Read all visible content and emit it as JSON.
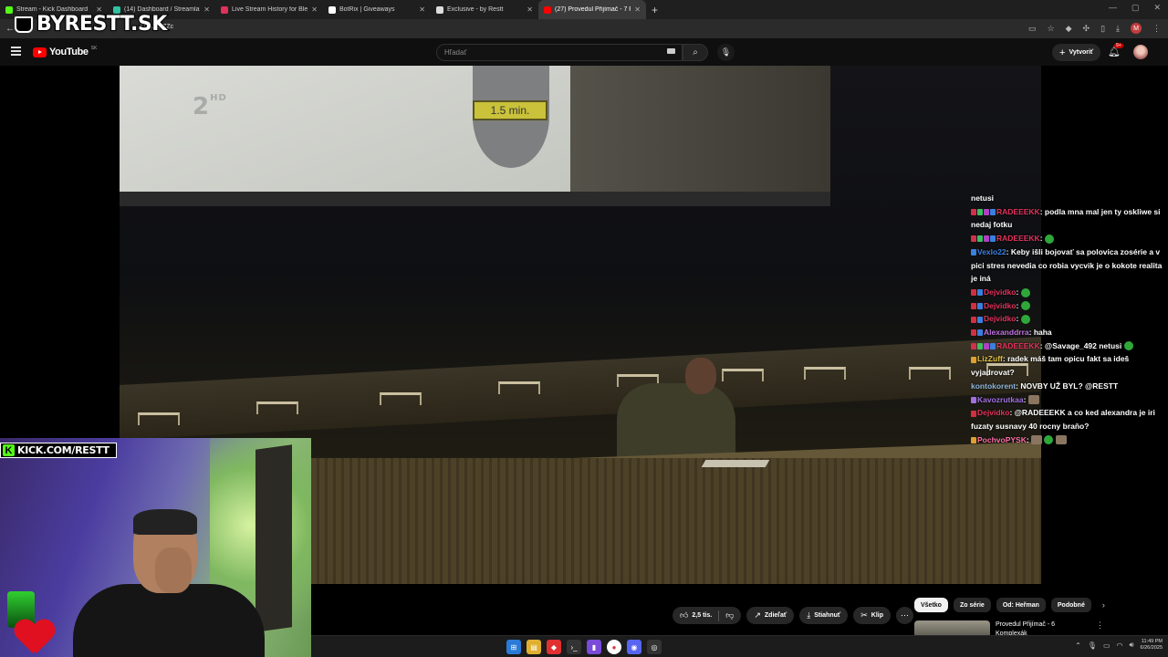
{
  "browser": {
    "tabs": [
      {
        "label": "Stream - Kick Dashboard",
        "color": "#53fc18",
        "active": false
      },
      {
        "label": "(14) Dashboard / Streamlabs",
        "color": "#31c3a2",
        "active": false
      },
      {
        "label": "Live Stream History for Blerp Si",
        "color": "#e0315a",
        "active": false
      },
      {
        "label": "BotRix | Giveaways",
        "color": "#ffffff",
        "active": false
      },
      {
        "label": "Exclusive - by Restt",
        "color": "#dddddd",
        "active": false
      },
      {
        "label": "(27) Provedul Přijímač - 7 P",
        "color": "#ff0000",
        "active": true
      }
    ],
    "url": "OTIJIUIZZc"
  },
  "overlay": {
    "logo_text": "BYRESTT.SK",
    "kick_text": "KICK.COM/RESTT"
  },
  "youtube": {
    "logo_text": "YouTube",
    "country_code": "SK",
    "search_placeholder": "Hľadať",
    "create_label": "Vytvoriť",
    "notif_count": "9+"
  },
  "video": {
    "channel_logo": "2",
    "channel_logo_hd": "HD",
    "timer_label": "1.5 min."
  },
  "chat": [
    {
      "user": "",
      "text": "netusi",
      "color": "#ffffff",
      "badges": []
    },
    {
      "user": "RADEEEKK",
      "text": "podla mna mal jen ty oskliwe si nedaj fotku",
      "color": "#e0325c",
      "badges": [
        "#d0304a",
        "#3ac060",
        "#b040c0",
        "#3a80e0"
      ]
    },
    {
      "user": "RADEEEKK",
      "text": "",
      "color": "#e0325c",
      "badges": [
        "#d0304a",
        "#3ac060",
        "#b040c0",
        "#3a80e0"
      ],
      "emotes": [
        "green"
      ]
    },
    {
      "user": "Vexlo22",
      "text": "Keby išli bojovať sa polovica zosérie a v pici stres nevedia co robia vycvik je o kokote realita je iná",
      "color": "#3a80e0",
      "badges": [
        "#3a80e0"
      ]
    },
    {
      "user": "Dejvidko",
      "text": "",
      "color": "#e0325c",
      "badges": [
        "#d03040",
        "#3a80e0"
      ],
      "emotes": [
        "green"
      ]
    },
    {
      "user": "Dejvidko",
      "text": "",
      "color": "#e0325c",
      "badges": [
        "#d03040",
        "#3a80e0"
      ],
      "emotes": [
        "green"
      ]
    },
    {
      "user": "Dejvidko",
      "text": "",
      "color": "#e0325c",
      "badges": [
        "#d03040",
        "#3a80e0"
      ],
      "emotes": [
        "green"
      ]
    },
    {
      "user": "Alexanddrra",
      "text": "haha",
      "color": "#c070e0",
      "badges": [
        "#d03040",
        "#3a80e0"
      ]
    },
    {
      "user": "RADEEEKK",
      "text": "@Savage_492 netusi",
      "color": "#e0325c",
      "badges": [
        "#d0304a",
        "#3ac060",
        "#b040c0",
        "#3a80e0"
      ],
      "emotes": [
        "green"
      ]
    },
    {
      "user": "LizZuff",
      "text": "radek máš tam opicu fakt sa ideš vyjadrovat?",
      "color": "#e0c040",
      "badges": [
        "#e0a030"
      ]
    },
    {
      "user": "kontokorent",
      "text": "NOVBY UŽ BYL? @RESTT",
      "color": "#90b8e0",
      "badges": []
    },
    {
      "user": "Kavozrutkaa",
      "text": "",
      "color": "#a070e0",
      "badges": [
        "#a070e0"
      ],
      "emotes": [
        "img"
      ]
    },
    {
      "user": "Dejvidko",
      "text": "@RADEEEKK a co ked alexandra je iri fuzaty susnavy 40 rocny braňo?",
      "color": "#e0325c",
      "badges": [
        "#d03040"
      ]
    },
    {
      "user": "PochvoPYSK",
      "text": "",
      "color": "#ff6fa8",
      "badges": [
        "#e0a030"
      ],
      "emotes": [
        "img",
        "green",
        "img"
      ]
    }
  ],
  "actions": {
    "like_count": "2,5 tis.",
    "share_label": "Zdieľať",
    "download_label": "Stiahnuť",
    "clip_label": "Klip"
  },
  "chips": [
    "Všetko",
    "Zo série",
    "Od: Heřman",
    "Podobné"
  ],
  "recommendation": {
    "title": "Provedul Přijímač - 6 Komplexák"
  },
  "taskbar": {
    "time": "11:49 PM",
    "date": "6/26/2025"
  }
}
